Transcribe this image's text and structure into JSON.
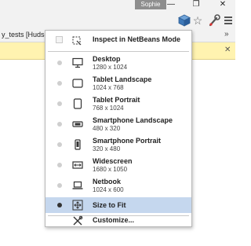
{
  "title_bar": {
    "user": "Sophie",
    "minimize": "—",
    "restore": "❐",
    "close": "✕"
  },
  "toolbar": {
    "netbeans_icon": "netbeans-cube-icon",
    "star": "☆",
    "wrench_icon": "wrench-icon",
    "menu_icon": "menu-icon"
  },
  "bookmarks_bar": {
    "text": "y_tests [Hudson",
    "more": "»"
  },
  "infobar": {
    "close": "✕"
  },
  "menu": {
    "inspect": {
      "label": "Inspect in NetBeans Mode"
    },
    "devices": [
      {
        "name": "Desktop",
        "size": "1280 x 1024",
        "icon": "desktop-icon"
      },
      {
        "name": "Tablet Landscape",
        "size": "1024 x 768",
        "icon": "tablet-landscape-icon"
      },
      {
        "name": "Tablet Portrait",
        "size": "768 x 1024",
        "icon": "tablet-portrait-icon"
      },
      {
        "name": "Smartphone Landscape",
        "size": "480 x 320",
        "icon": "smartphone-landscape-icon"
      },
      {
        "name": "Smartphone Portrait",
        "size": "320 x 480",
        "icon": "smartphone-portrait-icon"
      },
      {
        "name": "Widescreen",
        "size": "1680 x 1050",
        "icon": "widescreen-icon"
      },
      {
        "name": "Netbook",
        "size": "1024 x 600",
        "icon": "netbook-icon"
      }
    ],
    "size_to_fit": {
      "label": "Size to Fit",
      "selected": true
    },
    "customize": {
      "label": "Customize..."
    }
  },
  "colors": {
    "selected_highlight": "#c5d7ee",
    "infobar": "#fff3b0"
  }
}
